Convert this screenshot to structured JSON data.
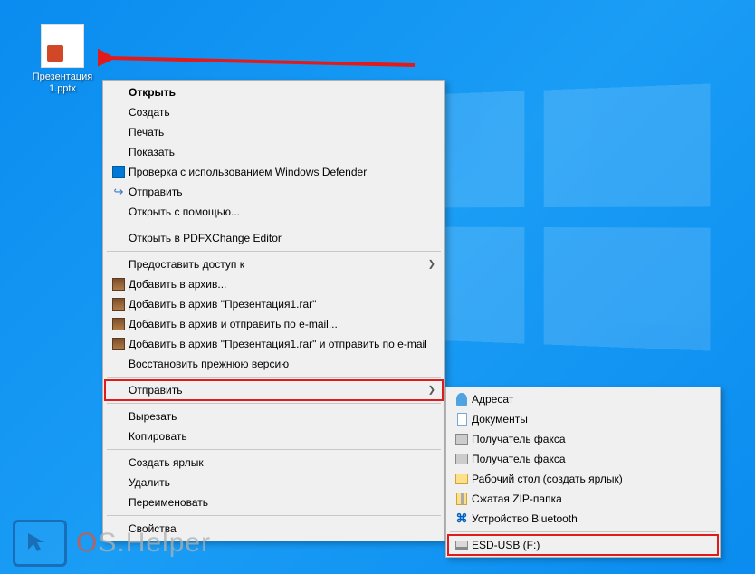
{
  "desktop": {
    "file_label": "Презентация\n1.pptx"
  },
  "context_menu": {
    "open": "Открыть",
    "create": "Создать",
    "print": "Печать",
    "show": "Показать",
    "defender": "Проверка с использованием Windows Defender",
    "send_share": "Отправить",
    "open_with": "Открыть с помощью...",
    "open_pdfx": "Открыть в PDFXChange Editor",
    "grant_access": "Предоставить доступ к",
    "rar_add": "Добавить в архив...",
    "rar_add_named": "Добавить в архив \"Презентация1.rar\"",
    "rar_add_email": "Добавить в архив и отправить по e-mail...",
    "rar_add_named_email": "Добавить в архив \"Презентация1.rar\" и отправить по e-mail",
    "restore_prev": "Восстановить прежнюю версию",
    "send_to": "Отправить",
    "cut": "Вырезать",
    "copy": "Копировать",
    "create_shortcut": "Создать ярлык",
    "delete": "Удалить",
    "rename": "Переименовать",
    "properties": "Свойства"
  },
  "send_to_submenu": {
    "recipient": "Адресат",
    "documents": "Документы",
    "fax1": "Получатель факса",
    "fax2": "Получатель факса",
    "desktop_shortcut": "Рабочий стол (создать ярлык)",
    "zip": "Сжатая ZIP-папка",
    "bluetooth": "Устройство Bluetooth",
    "drive": "ESD-USB (F:)"
  },
  "watermark": "OS.Helper"
}
